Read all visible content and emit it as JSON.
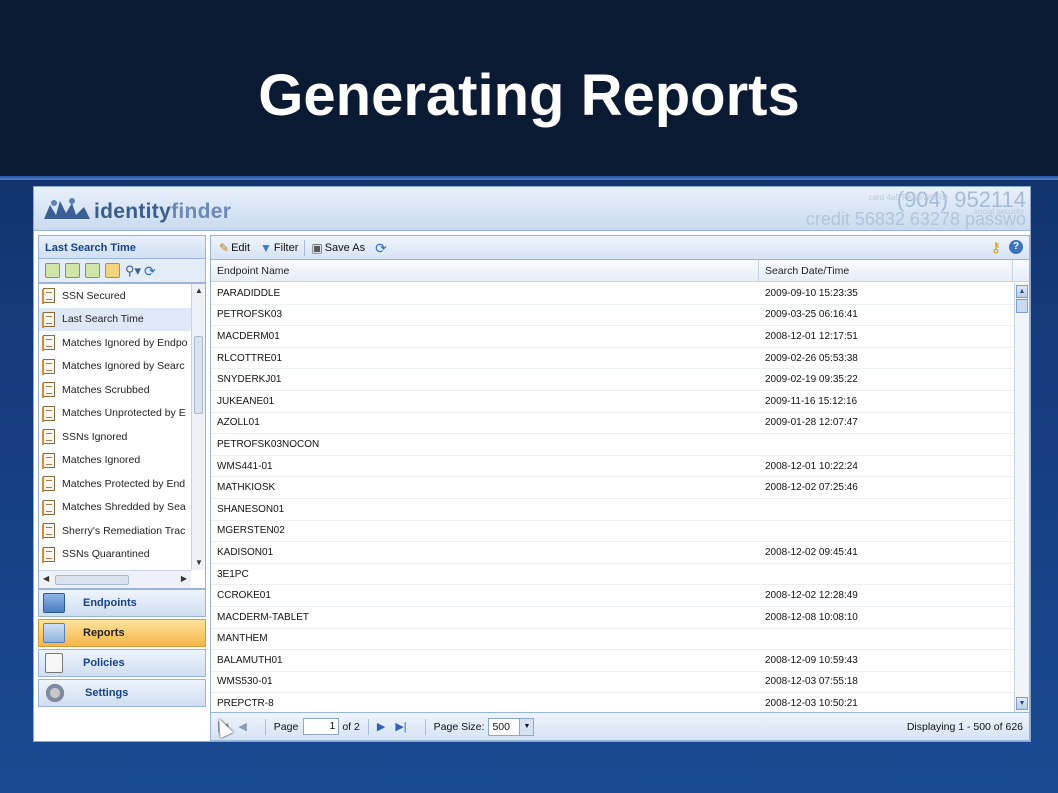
{
  "slide": {
    "title": "Generating Reports"
  },
  "app": {
    "logo_prefix": "identity",
    "logo_suffix": "finder",
    "banner_numbers": [
      "(904) 952114",
      "credit 56832 63278 passwo"
    ],
    "banner_small": [
      "card 4a5 PASSWORD",
      "social security"
    ]
  },
  "left_panel": {
    "header": "Last Search Time",
    "toolbar_icons": [
      "new-report-icon",
      "copy-report-icon",
      "import-report-icon",
      "folder-icon",
      "search-icon",
      "refresh-icon"
    ],
    "items": [
      {
        "label": "SSN Secured"
      },
      {
        "label": "Last Search Time"
      },
      {
        "label": "Matches Ignored by Endpo"
      },
      {
        "label": "Matches Ignored by Searc"
      },
      {
        "label": "Matches Scrubbed"
      },
      {
        "label": "Matches Unprotected by E"
      },
      {
        "label": "SSNs Ignored"
      },
      {
        "label": "Matches Ignored"
      },
      {
        "label": "Matches Protected by End"
      },
      {
        "label": "Matches Shredded by Sea"
      },
      {
        "label": "Sherry's Remediation Trac"
      },
      {
        "label": "SSNs Quarantined"
      }
    ],
    "selected_index": 1,
    "nav": [
      {
        "label": "Endpoints",
        "icon": "endpoints-icon"
      },
      {
        "label": "Reports",
        "icon": "reports-icon"
      },
      {
        "label": "Policies",
        "icon": "policies-icon"
      },
      {
        "label": "Settings",
        "icon": "settings-icon"
      }
    ],
    "active_nav": "Reports"
  },
  "grid": {
    "toolbar": {
      "edit": "Edit",
      "filter": "Filter",
      "save_as": "Save As"
    },
    "columns": [
      "Endpoint Name",
      "Search Date/Time"
    ],
    "rows": [
      [
        "PARADIDDLE",
        "2009-09-10 15:23:35"
      ],
      [
        "PETROFSK03",
        "2009-03-25 06:16:41"
      ],
      [
        "MACDERM01",
        "2008-12-01 12:17:51"
      ],
      [
        "RLCOTTRE01",
        "2009-02-26 05:53:38"
      ],
      [
        "SNYDERKJ01",
        "2009-02-19 09:35:22"
      ],
      [
        "JUKEANE01",
        "2009-11-16 15:12:16"
      ],
      [
        "AZOLL01",
        "2009-01-28 12:07:47"
      ],
      [
        "PETROFSK03NOCON",
        ""
      ],
      [
        "WMS441-01",
        "2008-12-01 10:22:24"
      ],
      [
        "MATHKIOSK",
        "2008-12-02 07:25:46"
      ],
      [
        "SHANESON01",
        ""
      ],
      [
        "MGERSTEN02",
        ""
      ],
      [
        "KADISON01",
        "2008-12-02 09:45:41"
      ],
      [
        "3E1PC",
        ""
      ],
      [
        "CCROKE01",
        "2008-12-02 12:28:49"
      ],
      [
        "MACDERM-TABLET",
        "2008-12-08 10:08:10"
      ],
      [
        "MANTHEM",
        ""
      ],
      [
        "BALAMUTH01",
        "2008-12-09 10:59:43"
      ],
      [
        "WMS530-01",
        "2008-12-03 07:55:18"
      ],
      [
        "PREPCTR-8",
        "2008-12-03 10:50:21"
      ]
    ]
  },
  "pager": {
    "page_label": "Page",
    "page_value": "1",
    "of_label": "of 2",
    "page_size_label": "Page Size:",
    "page_size_value": "500",
    "display_text": "Displaying 1 - 500 of 626"
  }
}
